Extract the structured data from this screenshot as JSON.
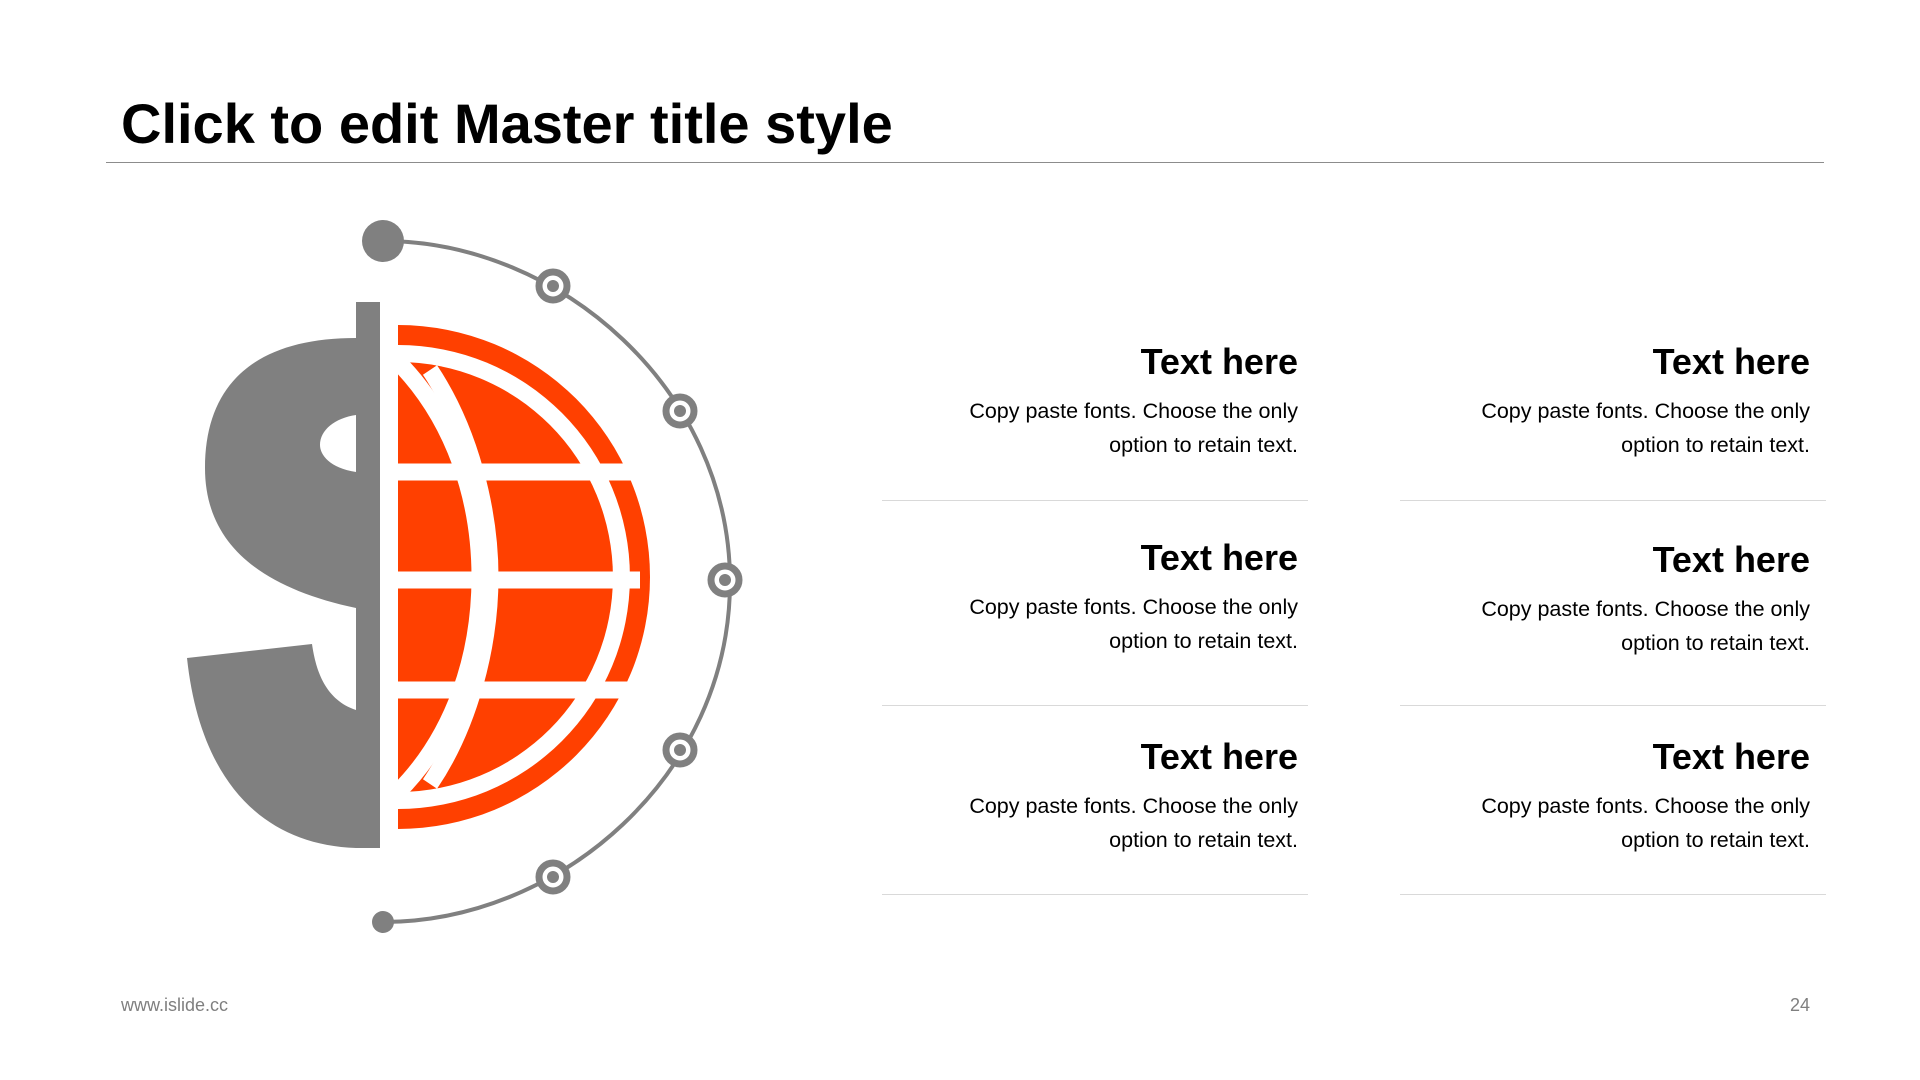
{
  "slide": {
    "title": "Click to edit Master title style",
    "footer_url": "www.islide.cc",
    "page_number": "24"
  },
  "graphic": {
    "icons": [
      "dollar-sign-icon",
      "globe-icon",
      "orbit-arc-icon"
    ],
    "colors": {
      "gray": "#808080",
      "orange": "#ff4000",
      "rule": "#8c8c8c",
      "divider": "#d9d9d9"
    }
  },
  "items": [
    {
      "heading": "Text here",
      "body": "Copy paste fonts. Choose the only option to retain text."
    },
    {
      "heading": "Text here",
      "body": "Copy paste fonts. Choose the only option to retain text."
    },
    {
      "heading": "Text here",
      "body": "Copy paste fonts. Choose the only option to retain text."
    },
    {
      "heading": "Text here",
      "body": "Copy paste fonts. Choose the only option to retain text."
    },
    {
      "heading": "Text here",
      "body": "Copy paste fonts. Choose the only option to retain text."
    },
    {
      "heading": "Text here",
      "body": "Copy paste fonts. Choose the only option to retain text."
    }
  ]
}
